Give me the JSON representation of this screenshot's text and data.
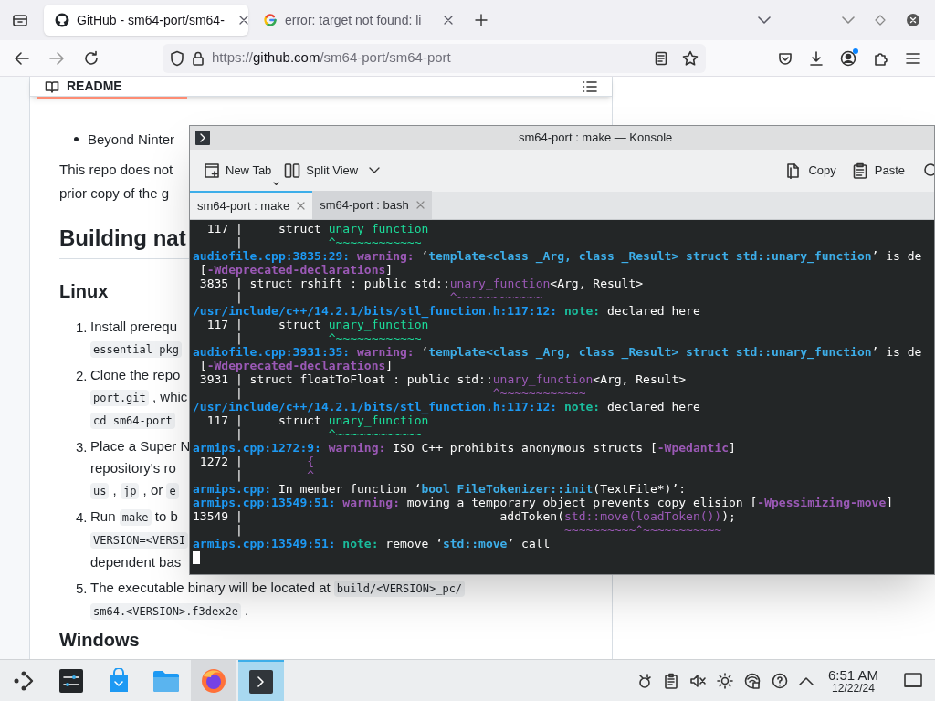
{
  "browser": {
    "tabs": [
      {
        "title": "GitHub - sm64-port/sm64-",
        "selected": true
      },
      {
        "title": "error: target not found: li",
        "selected": false
      }
    ],
    "url": {
      "scheme": "https://",
      "host": "github.com",
      "path": "/sm64-port/sm64-port"
    }
  },
  "readme": {
    "title": "README",
    "blocks": [
      {
        "kind": "bullet",
        "lines": [
          [
            "Beyond Ninter"
          ]
        ]
      },
      {
        "kind": "para",
        "lines": [
          [
            "This repo does not"
          ],
          [
            "prior copy of the g"
          ]
        ]
      },
      {
        "kind": "h2",
        "lines": [
          [
            "Building nat"
          ]
        ]
      },
      {
        "kind": "h3",
        "lines": [
          [
            "Linux"
          ]
        ]
      },
      {
        "kind": "item",
        "number": "1.",
        "lines": [
          [
            "Install prerequ"
          ],
          [
            {
              "code": "essential pkg"
            }
          ]
        ]
      },
      {
        "kind": "item",
        "number": "2.",
        "lines": [
          [
            "Clone the repo"
          ],
          [
            {
              "code": "port.git"
            },
            " , whic"
          ],
          [
            {
              "code": "cd sm64-port"
            }
          ]
        ]
      },
      {
        "kind": "item",
        "number": "3.",
        "lines": [
          [
            "Place a Super N"
          ],
          [
            "repository's ro"
          ],
          [
            {
              "code": "us"
            },
            " , ",
            {
              "code": "jp"
            },
            " , or ",
            {
              "code": "e"
            }
          ]
        ]
      },
      {
        "kind": "item",
        "number": "4.",
        "lines": [
          [
            "Run ",
            {
              "code": "make"
            },
            " to b"
          ],
          [
            {
              "code": "VERSION=<VERSI"
            }
          ],
          [
            "dependent bas"
          ]
        ]
      },
      {
        "kind": "item",
        "number": "5.",
        "lines": [
          [
            "The executable binary will be located at ",
            {
              "code": "build/<VERSION>_pc/"
            }
          ],
          [
            {
              "code": "sm64.<VERSION>.f3dex2e"
            },
            " ."
          ]
        ]
      },
      {
        "kind": "h3",
        "lines": [
          [
            "Windows"
          ]
        ]
      }
    ]
  },
  "konsole": {
    "title": "sm64-port : make — Konsole",
    "toolbar_left": [
      "New Tab",
      "Split View"
    ],
    "toolbar_right": [
      "Copy",
      "Paste"
    ],
    "tabs": [
      {
        "label": "sm64-port : make",
        "selected": true
      },
      {
        "label": "sm64-port : bash",
        "selected": false
      }
    ],
    "cursor": true,
    "lines": [
      [
        "  117 |     struct ",
        {
          "kind": "green",
          "text": "unary_function"
        }
      ],
      [
        "      |            ",
        {
          "kind": "green",
          "text": "^~~~~~~~~~~~~"
        }
      ],
      [
        {
          "kind": "loc",
          "text": "audiofile.cpp:3835:29:"
        },
        {
          "kind": "warning",
          "text": " warning:"
        },
        " ‘",
        {
          "kind": "quote",
          "text": "template<class _Arg, class _Result> struct std::unary_function"
        },
        "’ is de"
      ],
      [
        " [",
        {
          "kind": "warning",
          "text": "-Wdeprecated-declarations"
        },
        "]"
      ],
      [
        " 3835 | struct rshift : public std::",
        {
          "kind": "purple",
          "text": "unary_function"
        },
        "<Arg, Result>"
      ],
      [
        "      |                             ",
        {
          "kind": "purple",
          "text": "^~~~~~~~~~~~~"
        }
      ],
      [
        {
          "kind": "loc",
          "text": "/usr/include/c++/14.2.1/bits/stl_function.h:117:12:"
        },
        {
          "kind": "note",
          "text": " note:"
        },
        " declared here"
      ],
      [
        "  117 |     struct ",
        {
          "kind": "green",
          "text": "unary_function"
        }
      ],
      [
        "      |            ",
        {
          "kind": "green",
          "text": "^~~~~~~~~~~~~"
        }
      ],
      [
        {
          "kind": "loc",
          "text": "audiofile.cpp:3931:35:"
        },
        {
          "kind": "warning",
          "text": " warning:"
        },
        " ‘",
        {
          "kind": "quote",
          "text": "template<class _Arg, class _Result> struct std::unary_function"
        },
        "’ is de"
      ],
      [
        " [",
        {
          "kind": "warning",
          "text": "-Wdeprecated-declarations"
        },
        "]"
      ],
      [
        " 3931 | struct floatToFloat : public std::",
        {
          "kind": "purple",
          "text": "unary_function"
        },
        "<Arg, Result>"
      ],
      [
        "      |                                   ",
        {
          "kind": "purple",
          "text": "^~~~~~~~~~~~~"
        }
      ],
      [
        {
          "kind": "loc",
          "text": "/usr/include/c++/14.2.1/bits/stl_function.h:117:12:"
        },
        {
          "kind": "note",
          "text": " note:"
        },
        " declared here"
      ],
      [
        "  117 |     struct ",
        {
          "kind": "green",
          "text": "unary_function"
        }
      ],
      [
        "      |            ",
        {
          "kind": "green",
          "text": "^~~~~~~~~~~~~"
        }
      ],
      [
        {
          "kind": "loc",
          "text": "armips.cpp:1272:9:"
        },
        {
          "kind": "warning",
          "text": " warning:"
        },
        " ISO C++ prohibits anonymous structs [",
        {
          "kind": "warning",
          "text": "-Wpedantic"
        },
        "]"
      ],
      [
        " 1272 |         ",
        {
          "kind": "purple",
          "text": "{"
        }
      ],
      [
        "      |         ",
        {
          "kind": "purple",
          "text": "^"
        }
      ],
      [
        {
          "kind": "loc",
          "text": "armips.cpp:"
        },
        " In member function ‘",
        {
          "kind": "quote",
          "text": "bool FileTokenizer::init"
        },
        "(TextFile*)’:"
      ],
      [
        {
          "kind": "loc",
          "text": "armips.cpp:13549:51:"
        },
        {
          "kind": "warning",
          "text": " warning:"
        },
        " moving a temporary object prevents copy elision [",
        {
          "kind": "warning",
          "text": "-Wpessimizing-move"
        },
        "]"
      ],
      [
        "13549 |                                    addToken(",
        {
          "kind": "purple",
          "text": "std::move(loadToken())"
        },
        ");"
      ],
      [
        "      |                                             ",
        {
          "kind": "purple",
          "text": "~~~~~~~~~~^~~~~~~~~~~~"
        }
      ],
      [
        {
          "kind": "loc",
          "text": "armips.cpp:13549:51:"
        },
        {
          "kind": "note",
          "text": " note:"
        },
        " remove ‘",
        {
          "kind": "quote",
          "text": "std::move"
        },
        "’ call"
      ]
    ]
  },
  "taskbar": {
    "apps": [
      {
        "kind": "launcher",
        "running": false,
        "selected": false
      },
      {
        "kind": "settings",
        "running": false,
        "selected": false
      },
      {
        "kind": "store",
        "running": false,
        "selected": false
      },
      {
        "kind": "files",
        "running": false,
        "selected": false
      },
      {
        "kind": "firefox",
        "running": true,
        "selected": false
      },
      {
        "kind": "terminal",
        "running": true,
        "selected": true
      }
    ],
    "time": "6:51 AM",
    "date": "12/22/24"
  }
}
